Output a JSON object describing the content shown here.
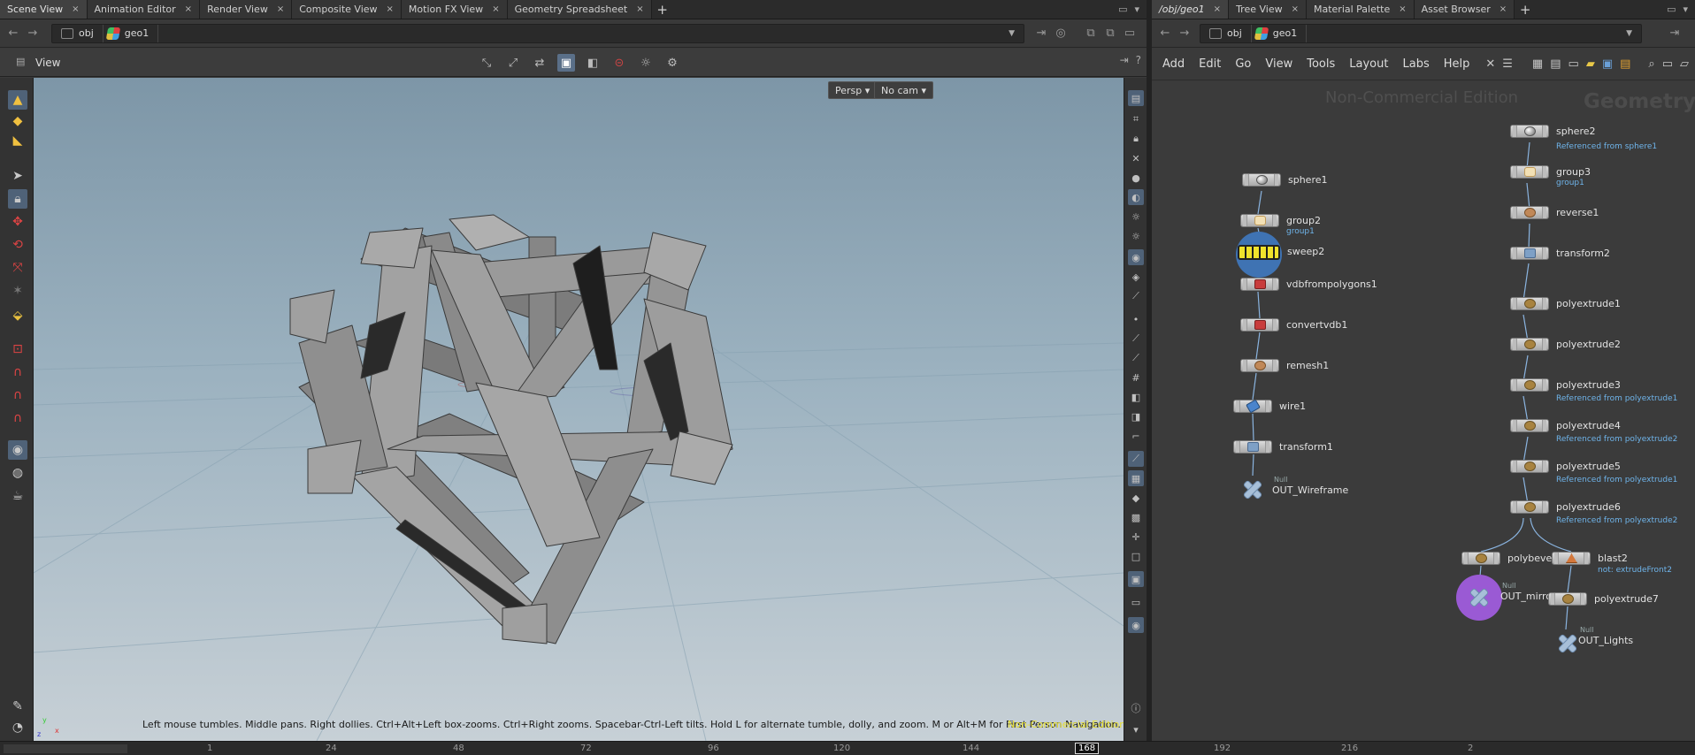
{
  "left_tabs": [
    {
      "label": "Scene View"
    },
    {
      "label": "Animation Editor"
    },
    {
      "label": "Render View"
    },
    {
      "label": "Composite View"
    },
    {
      "label": "Motion FX View"
    },
    {
      "label": "Geometry Spreadsheet"
    }
  ],
  "right_tabs": [
    {
      "label": "/obj/geo1"
    },
    {
      "label": "Tree View"
    },
    {
      "label": "Material Palette"
    },
    {
      "label": "Asset Browser"
    }
  ],
  "left_path": {
    "root": "obj",
    "node": "geo1"
  },
  "right_path": {
    "root": "obj",
    "node": "geo1"
  },
  "viewer": {
    "title": "View",
    "persp_label": "Persp ▾",
    "camera_label": "No cam ▾",
    "hint": "Left mouse tumbles. Middle pans. Right dollies. Ctrl+Alt+Left box-zooms. Ctrl+Right zooms. Spacebar-Ctrl-Left tilts. Hold L for alternate tumble, dolly, and zoom.     M or Alt+M for First Person Navigation.",
    "edition": "Non-Commercial Edition",
    "axis": {
      "x": "x",
      "y": "y",
      "z": "z"
    }
  },
  "network_menu": [
    "Add",
    "Edit",
    "Go",
    "View",
    "Tools",
    "Layout",
    "Labs",
    "Help"
  ],
  "network": {
    "watermark_edition": "Non-Commercial Edition",
    "watermark_context": "Geometry",
    "nodes": {
      "sphere1": {
        "name": "sphere1"
      },
      "group2": {
        "name": "group2",
        "sub": "group1"
      },
      "sweep2": {
        "name": "sweep2"
      },
      "vdbfrompolygons1": {
        "name": "vdbfrompolygons1"
      },
      "convertvdb1": {
        "name": "convertvdb1"
      },
      "remesh1": {
        "name": "remesh1"
      },
      "wire1": {
        "name": "wire1"
      },
      "transform1": {
        "name": "transform1"
      },
      "out_wireframe": {
        "name": "OUT_Wireframe",
        "type": "Null"
      },
      "sphere2": {
        "name": "sphere2",
        "sub": "Referenced from sphere1"
      },
      "group3": {
        "name": "group3",
        "sub": "group1"
      },
      "reverse1": {
        "name": "reverse1"
      },
      "transform2": {
        "name": "transform2"
      },
      "polyextrude1": {
        "name": "polyextrude1"
      },
      "polyextrude2": {
        "name": "polyextrude2"
      },
      "polyextrude3": {
        "name": "polyextrude3",
        "sub": "Referenced from polyextrude1"
      },
      "polyextrude4": {
        "name": "polyextrude4",
        "sub": "Referenced from polyextrude2"
      },
      "polyextrude5": {
        "name": "polyextrude5",
        "sub": "Referenced from polyextrude1"
      },
      "polyextrude6": {
        "name": "polyextrude6",
        "sub": "Referenced from polyextrude2"
      },
      "polybevel1": {
        "name": "polybevel1"
      },
      "out_mirror": {
        "name": "OUT_mirror",
        "type": "Null"
      },
      "blast2": {
        "name": "blast2",
        "sub": "not: extrudeFront2"
      },
      "polyextrude7": {
        "name": "polyextrude7"
      },
      "out_lights": {
        "name": "OUT_Lights",
        "type": "Null"
      }
    }
  },
  "timeline": {
    "marks": [
      "1",
      "24",
      "48",
      "72",
      "96",
      "120",
      "144",
      "192",
      "216",
      "2"
    ],
    "current_frame": "168"
  }
}
